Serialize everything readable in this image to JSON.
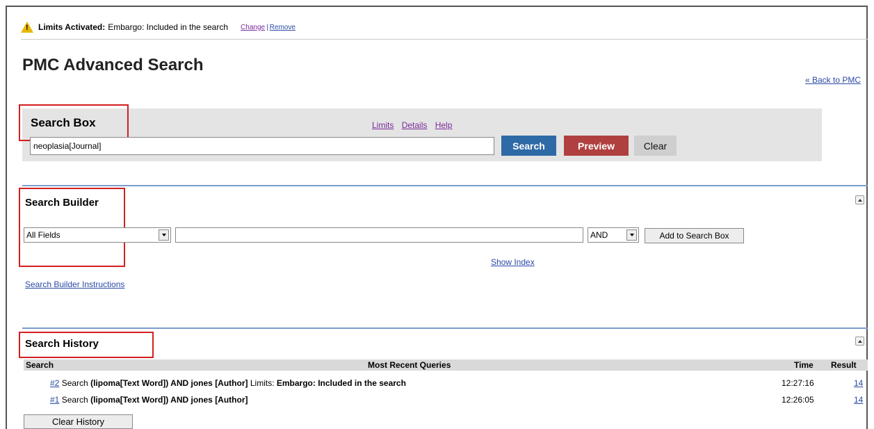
{
  "limits_bar": {
    "icon": "warning-icon",
    "label": "Limits Activated:",
    "text": "Embargo: Included in the search",
    "change_link": "Change",
    "separator": "|",
    "remove_link": "Remove"
  },
  "page_title": "PMC Advanced Search",
  "back_link": "« Back to PMC",
  "search_box": {
    "title": "Search Box",
    "links": [
      "Limits",
      "Details",
      "Help"
    ],
    "query_value": "neoplasia[Journal]",
    "search_button": "Search",
    "preview_button": "Preview",
    "clear_button": "Clear"
  },
  "search_builder": {
    "title": "Search Builder",
    "field_select": "All Fields",
    "term_value": "",
    "operator_select": "AND",
    "add_button": "Add to Search Box",
    "show_index_link": "Show Index",
    "instructions_link": "Search Builder Instructions"
  },
  "search_history": {
    "title": "Search History",
    "columns": [
      "Search",
      "Most Recent Queries",
      "Time",
      "Result"
    ],
    "rows": [
      {
        "id": "#2",
        "prefix": "Search",
        "query": "(lipoma[Text Word]) AND jones [Author]",
        "limits_label": "Limits:",
        "limits": "Embargo: Included in the search",
        "time": "12:27:16",
        "result": "14"
      },
      {
        "id": "#1",
        "prefix": "Search",
        "query": "(lipoma[Text Word]) AND jones [Author]",
        "limits_label": "",
        "limits": "",
        "time": "12:26:05",
        "result": "14"
      }
    ],
    "clear_button": "Clear History"
  },
  "colors": {
    "search_button": "#2e6aa6",
    "preview_button": "#b04040",
    "highlight_box": "#d31f1f",
    "section_divider": "#7a9cc9",
    "link": "#2a4aa6"
  }
}
